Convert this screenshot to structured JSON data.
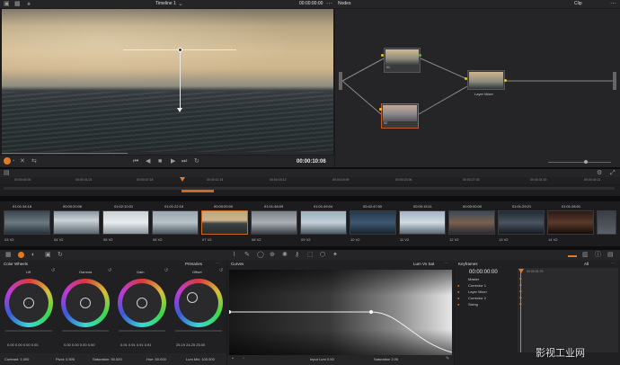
{
  "app": {
    "timeline_name": "Timeline 1",
    "viewer_timecode_top": "00:00:00:00",
    "nodes_label": "Nodes",
    "clip_label": "Clip"
  },
  "viewer": {
    "timecode": "00:00:10:06"
  },
  "nodes": {
    "node1": "01",
    "node2": "02",
    "mixer": "Layer Mixer"
  },
  "timeline": {
    "ruler": [
      "00:00:00:00",
      "00:00:01:21",
      "00:00:07:18",
      "00:00:11:15",
      "00:00:15:12",
      "00:00:19:09",
      "00:00:23:06",
      "00:00:27:03",
      "00:00:31:00",
      "00:00:34:21"
    ],
    "clips": [
      {
        "tc": "01:01:34:18",
        "lbl": "03",
        "trk": "V2"
      },
      {
        "tc": "00:00:20:06",
        "lbl": "04",
        "trk": "V2"
      },
      {
        "tc": "01:02:10:01",
        "lbl": "05",
        "trk": "V2"
      },
      {
        "tc": "01:01:22:16",
        "lbl": "06",
        "trk": "V2"
      },
      {
        "tc": "00:00:00:00",
        "lbl": "07",
        "trk": "V2"
      },
      {
        "tc": "01:01:48:09",
        "lbl": "08",
        "trk": "V2"
      },
      {
        "tc": "01:01:49:04",
        "lbl": "09",
        "trk": "V2"
      },
      {
        "tc": "00:42:47:00",
        "lbl": "10",
        "trk": "V2"
      },
      {
        "tc": "00:00:15:11",
        "lbl": "11",
        "trk": "V2"
      },
      {
        "tc": "00:00:00:00",
        "lbl": "12",
        "trk": "V2"
      },
      {
        "tc": "01:01:29:21",
        "lbl": "13",
        "trk": "V2"
      },
      {
        "tc": "01:01:28:01",
        "lbl": "14",
        "trk": "V2"
      }
    ]
  },
  "color_wheels": {
    "title": "Color Wheels",
    "mode": "Primaries",
    "wheels": [
      {
        "name": "Lift",
        "vals": "0.00  0.00  0.00  0.00"
      },
      {
        "name": "Gamma",
        "vals": "0.00  0.00  0.00  0.00"
      },
      {
        "name": "Gain",
        "vals": "0.91  0.91  0.91  0.91"
      },
      {
        "name": "Offset",
        "vals": "25.19  24.25  25.00"
      }
    ],
    "footer": {
      "contrast": "Contrast: 1.000",
      "pivot": "Pivot: 0.500",
      "saturation": "Saturation: 50.000",
      "hue": "Hue: 50.000",
      "lummix": "Lum Mix: 100.000"
    }
  },
  "curves": {
    "title": "Curves",
    "mode": "Lum Vs Sat",
    "input_lum": "Input Lum  0.00",
    "saturation": "Saturation  2.00"
  },
  "keyframes": {
    "title": "Keyframes",
    "filter": "All",
    "timecode": "00:00:00:00",
    "end_tc": "00:00:01:75",
    "rows": [
      "Master",
      "Corrector 1",
      "Layer Mixer",
      "Corrector 2",
      "Sizing"
    ]
  },
  "watermark": "影视工业网"
}
